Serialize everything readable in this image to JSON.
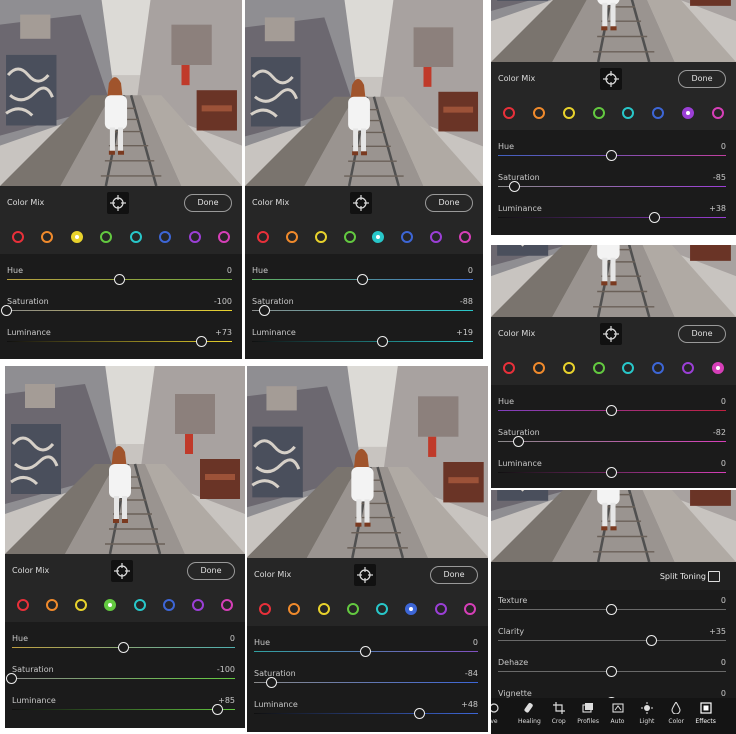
{
  "common": {
    "color_mix_title": "Color Mix",
    "done_label": "Done",
    "hue_label": "Hue",
    "saturation_label": "Saturation",
    "luminance_label": "Luminance"
  },
  "swatch_colors": [
    "#e8303a",
    "#f08a2c",
    "#e8d22c",
    "#63c940",
    "#28c7c9",
    "#3d66d6",
    "#9b3fd6",
    "#d63fb8"
  ],
  "panels": [
    {
      "selected": 2,
      "hue": {
        "value": "0",
        "level": 0.5
      },
      "saturation": {
        "value": "-100",
        "level": 0.0
      },
      "luminance": {
        "value": "+73",
        "level": 0.865
      }
    },
    {
      "selected": 4,
      "hue": {
        "value": "0",
        "level": 0.5
      },
      "saturation": {
        "value": "-88",
        "level": 0.06
      },
      "luminance": {
        "value": "+19",
        "level": 0.595
      }
    },
    {
      "selected": 6,
      "hue": {
        "value": "0",
        "level": 0.5
      },
      "saturation": {
        "value": "-85",
        "level": 0.075
      },
      "luminance": {
        "value": "+38",
        "level": 0.69
      }
    },
    {
      "selected": 7,
      "hue": {
        "value": "0",
        "level": 0.5
      },
      "saturation": {
        "value": "-82",
        "level": 0.09
      },
      "luminance": {
        "value": "0",
        "level": 0.5
      }
    },
    {
      "selected": 3,
      "hue": {
        "value": "0",
        "level": 0.5
      },
      "saturation": {
        "value": "-100",
        "level": 0.0
      },
      "luminance": {
        "value": "+85",
        "level": 0.925
      }
    },
    {
      "selected": 5,
      "hue": {
        "value": "0",
        "level": 0.5
      },
      "saturation": {
        "value": "-84",
        "level": 0.08
      },
      "luminance": {
        "value": "+48",
        "level": 0.74
      }
    }
  ],
  "effects": {
    "title": "Split Toning",
    "sliders": [
      {
        "label": "Texture",
        "value": "0",
        "level": 0.5
      },
      {
        "label": "Clarity",
        "value": "+35",
        "level": 0.675
      },
      {
        "label": "Dehaze",
        "value": "0",
        "level": 0.5
      },
      {
        "label": "Vignette",
        "value": "0",
        "level": 0.5
      }
    ],
    "toolbar": [
      {
        "label": "ve",
        "icon": "partial-tool-icon"
      },
      {
        "label": "Healing",
        "icon": "healing-icon"
      },
      {
        "label": "Crop",
        "icon": "crop-icon"
      },
      {
        "label": "Profiles",
        "icon": "profiles-icon"
      },
      {
        "label": "Auto",
        "icon": "auto-icon"
      },
      {
        "label": "Light",
        "icon": "light-icon"
      },
      {
        "label": "Color",
        "icon": "color-icon"
      },
      {
        "label": "Effects",
        "icon": "effects-icon"
      }
    ]
  }
}
